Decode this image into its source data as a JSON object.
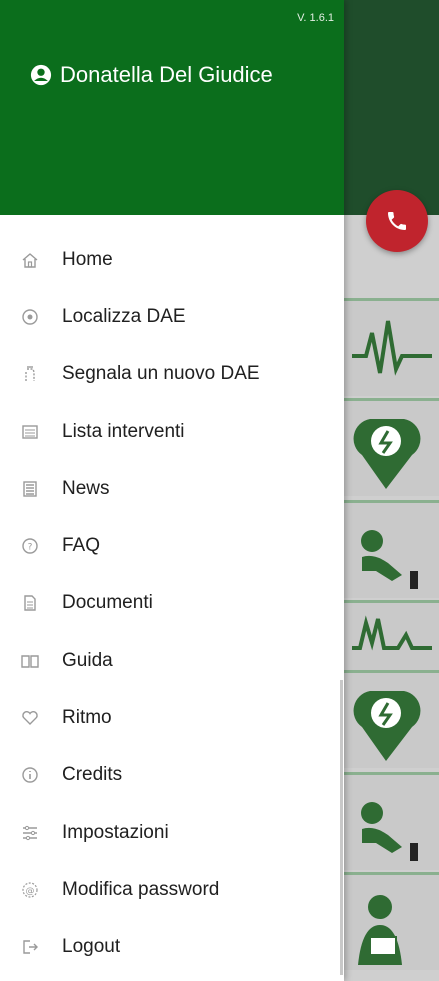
{
  "app": {
    "version": "V. 1.6.1",
    "user_name": "Donatella Del Giudice"
  },
  "menu": [
    {
      "label": "Home",
      "icon": "home-icon"
    },
    {
      "label": "Localizza DAE",
      "icon": "location-icon"
    },
    {
      "label": "Segnala un nuovo DAE",
      "icon": "report-dae-icon"
    },
    {
      "label": "Lista interventi",
      "icon": "list-icon"
    },
    {
      "label": "News",
      "icon": "news-icon"
    },
    {
      "label": "FAQ",
      "icon": "help-icon"
    },
    {
      "label": "Documenti",
      "icon": "document-icon"
    },
    {
      "label": "Guida",
      "icon": "book-icon"
    },
    {
      "label": "Ritmo",
      "icon": "heart-icon"
    },
    {
      "label": "Credits",
      "icon": "info-icon"
    },
    {
      "label": "Impostazioni",
      "icon": "settings-icon"
    },
    {
      "label": "Modifica password",
      "icon": "password-icon"
    },
    {
      "label": "Logout",
      "icon": "logout-icon"
    }
  ],
  "colors": {
    "header_green": "#0b6e1c",
    "fab_red": "#c0242d",
    "icon_green": "#2f6b33"
  }
}
